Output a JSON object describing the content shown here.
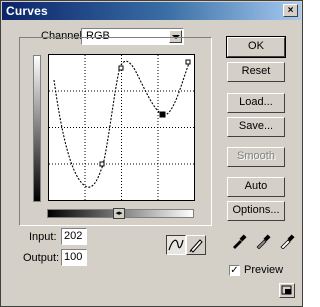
{
  "window": {
    "title": "Curves",
    "close_glyph": "×"
  },
  "channel": {
    "label": "Channel:",
    "value": "RGB"
  },
  "input": {
    "label": "Input:",
    "value": "202"
  },
  "output": {
    "label": "Output:",
    "value": "100"
  },
  "buttons": {
    "ok": "OK",
    "reset": "Reset",
    "load": "Load...",
    "save": "Save...",
    "smooth": "Smooth",
    "auto": "Auto",
    "options": "Options..."
  },
  "preview": {
    "label": "Preview",
    "checked": true,
    "check_glyph": "✓"
  },
  "curve": {
    "color": "#000000",
    "grid_color": "#000000"
  }
}
